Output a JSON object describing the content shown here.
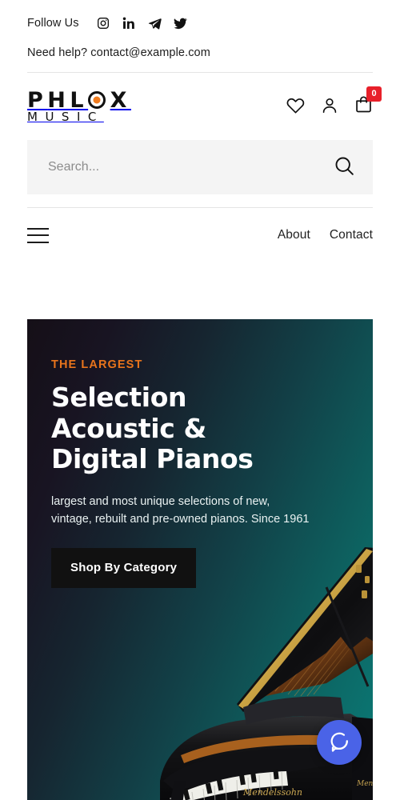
{
  "topbar": {
    "follow_label": "Follow Us",
    "social": [
      {
        "name": "instagram-icon",
        "label": "Instagram"
      },
      {
        "name": "linkedin-icon",
        "label": "LinkedIn"
      },
      {
        "name": "telegram-icon",
        "label": "Telegram"
      },
      {
        "name": "twitter-icon",
        "label": "Twitter"
      }
    ],
    "help_text": "Need help? contact@example.com"
  },
  "header": {
    "logo_p": "P",
    "logo_h": "H",
    "logo_l": "L",
    "logo_x": "X",
    "logo_sub": "MUSIC",
    "wishlist_label": "Wishlist",
    "account_label": "Account",
    "cart_label": "Cart",
    "cart_count": "0"
  },
  "search": {
    "placeholder": "Search...",
    "value": "",
    "button_label": "Search"
  },
  "nav": {
    "menu_label": "Menu",
    "links": [
      {
        "label": "About"
      },
      {
        "label": "Contact"
      }
    ]
  },
  "hero": {
    "eyebrow": "THE LARGEST",
    "title_line1": "Selection",
    "title_line2": "Acoustic &",
    "title_line3": "Digital Pianos",
    "subtitle_line1": "largest and most unique selections of new,",
    "subtitle_line2": "vintage, rebuilt and pre-owned pianos. Since 1961",
    "cta_label": "Shop By Category",
    "piano_brand": "Mendelssohn"
  },
  "beacon": {
    "label": "Help chat",
    "icon": "chat-bubble-icon"
  },
  "colors": {
    "accent_orange": "#e8741c",
    "logo_dot": "#f07c1f",
    "cart_badge_red": "#e8202a",
    "beacon_blue": "#4a63e7",
    "hero_gradient_from": "#150f17",
    "hero_gradient_to": "#0a7b77",
    "search_bg": "#f4f4f4",
    "divider": "#e4e4e4"
  }
}
